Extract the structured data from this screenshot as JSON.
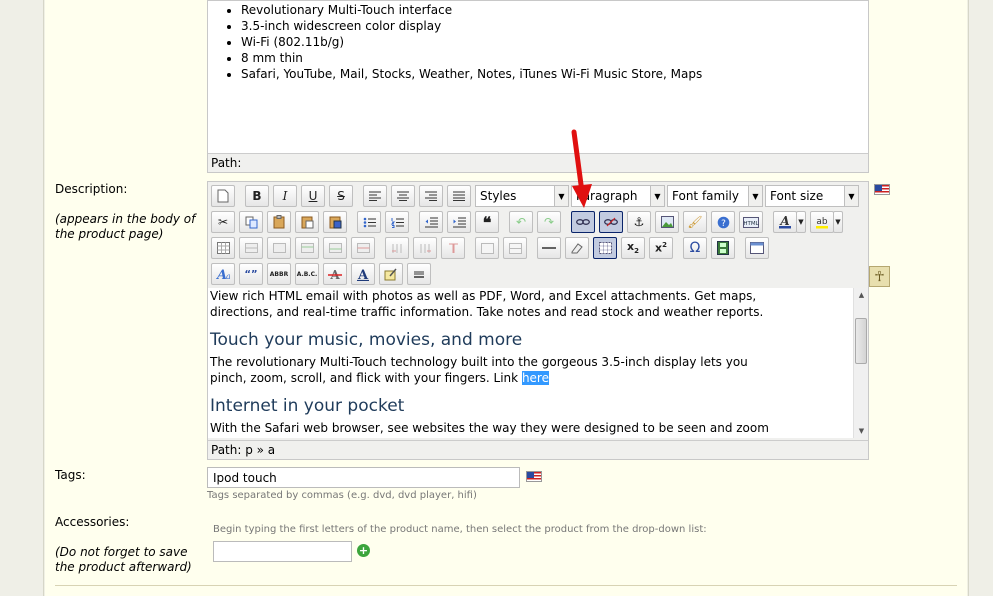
{
  "top_editor": {
    "bullets": [
      "Revolutionary Multi-Touch interface",
      "3.5-inch widescreen color display",
      "Wi-Fi (802.11b/g)",
      "8 mm thin",
      "Safari, YouTube, Mail, Stocks, Weather, Notes, iTunes Wi-Fi Music Store, Maps"
    ],
    "path": "Path:"
  },
  "description": {
    "label": "Description:",
    "hint": "(appears in the body of the product page)",
    "toolbar": {
      "styles": "Styles",
      "paragraph": "Paragraph",
      "font_family": "Font family",
      "font_size": "Font size"
    },
    "content": {
      "p1": "View rich HTML email with photos as well as PDF, Word, and Excel attachments. Get maps, directions, and real-time traffic information. Take notes and read stock and weather reports.",
      "h1": "Touch your music, movies, and more",
      "p2": "The revolutionary Multi-Touch technology built into the gorgeous 3.5-inch display lets you pinch, zoom, scroll, and flick with your fingers. Link ",
      "link_text": "here",
      "h2": "Internet in your pocket",
      "p3": "With the Safari web browser, see websites the way they were designed to be seen and zoom in and out with a tap."
    },
    "path": "Path: p » a"
  },
  "tags": {
    "label": "Tags:",
    "value": "Ipod touch",
    "note": "Tags separated by commas (e.g. dvd, dvd player, hifi)"
  },
  "accessories": {
    "label": "Accessories:",
    "hint": "(Do not forget to save the product afterward)",
    "note": "Begin typing the first letters of the product name, then select the product from the drop-down list:",
    "value": ""
  },
  "colors": {
    "panel": "#ffffee",
    "heading": "#1f3b5a",
    "selection": "#3399ff",
    "arrow": "#e01010"
  }
}
